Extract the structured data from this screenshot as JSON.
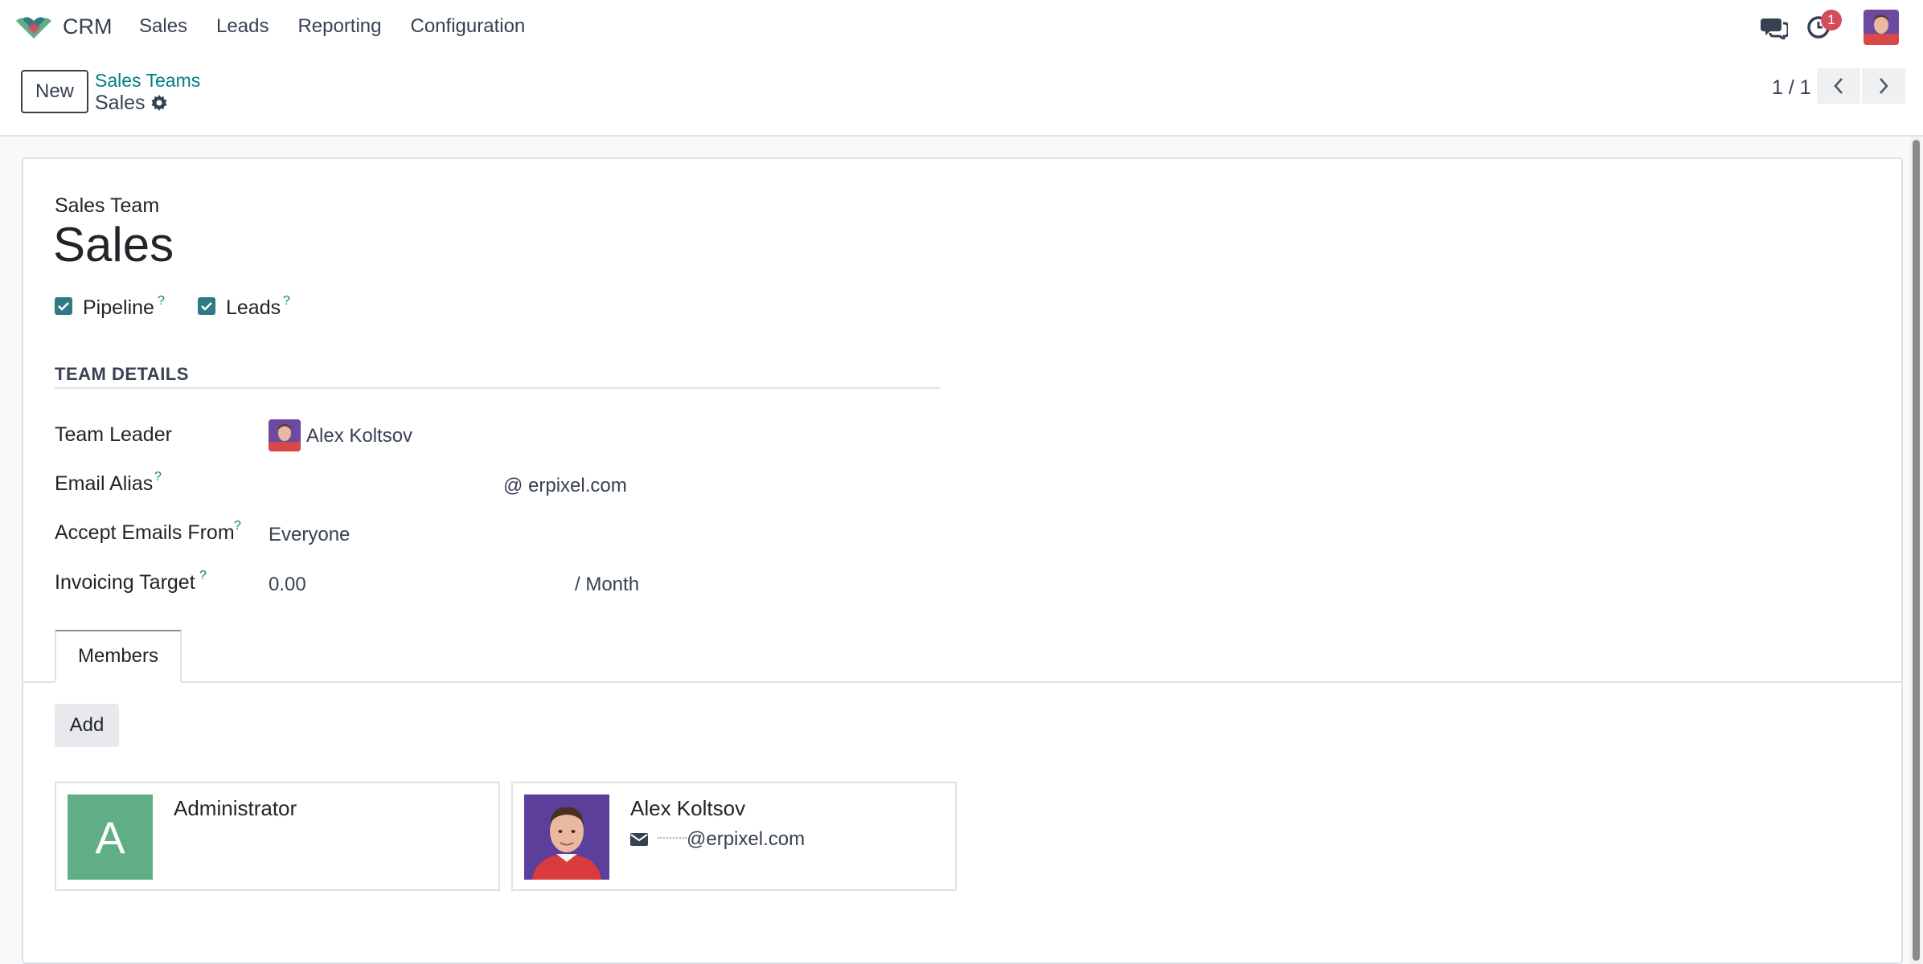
{
  "navbar": {
    "app_name": "CRM",
    "menu": [
      "Sales",
      "Leads",
      "Reporting",
      "Configuration"
    ],
    "notification_count": "1"
  },
  "control_panel": {
    "new_label": "New",
    "breadcrumb_parent": "Sales Teams",
    "breadcrumb_current": "Sales",
    "pager": "1 / 1"
  },
  "form": {
    "record_label": "Sales Team",
    "record_title": "Sales",
    "options": [
      {
        "label": "Pipeline",
        "checked": true
      },
      {
        "label": "Leads",
        "checked": true
      }
    ],
    "help_mark": "?",
    "section_title": "TEAM DETAILS",
    "fields": {
      "team_leader": {
        "label": "Team Leader",
        "value": "Alex Koltsov"
      },
      "email_alias": {
        "label": "Email Alias",
        "value": "@ erpixel.com"
      },
      "accept_emails": {
        "label": "Accept Emails From",
        "value": "Everyone"
      },
      "invoicing_target": {
        "label": "Invoicing Target",
        "value": "0.00",
        "unit": "/ Month"
      }
    }
  },
  "tabs": {
    "members_label": "Members",
    "add_label": "Add",
    "members": [
      {
        "initial": "A",
        "name": "Administrator",
        "email": ""
      },
      {
        "initial": "",
        "name": "Alex Koltsov",
        "email": "@erpixel.com"
      }
    ]
  },
  "colors": {
    "accent": "#017e84",
    "checkbox": "#2f7b85",
    "badge": "#d44c59",
    "admin_avatar": "#5fae86"
  }
}
